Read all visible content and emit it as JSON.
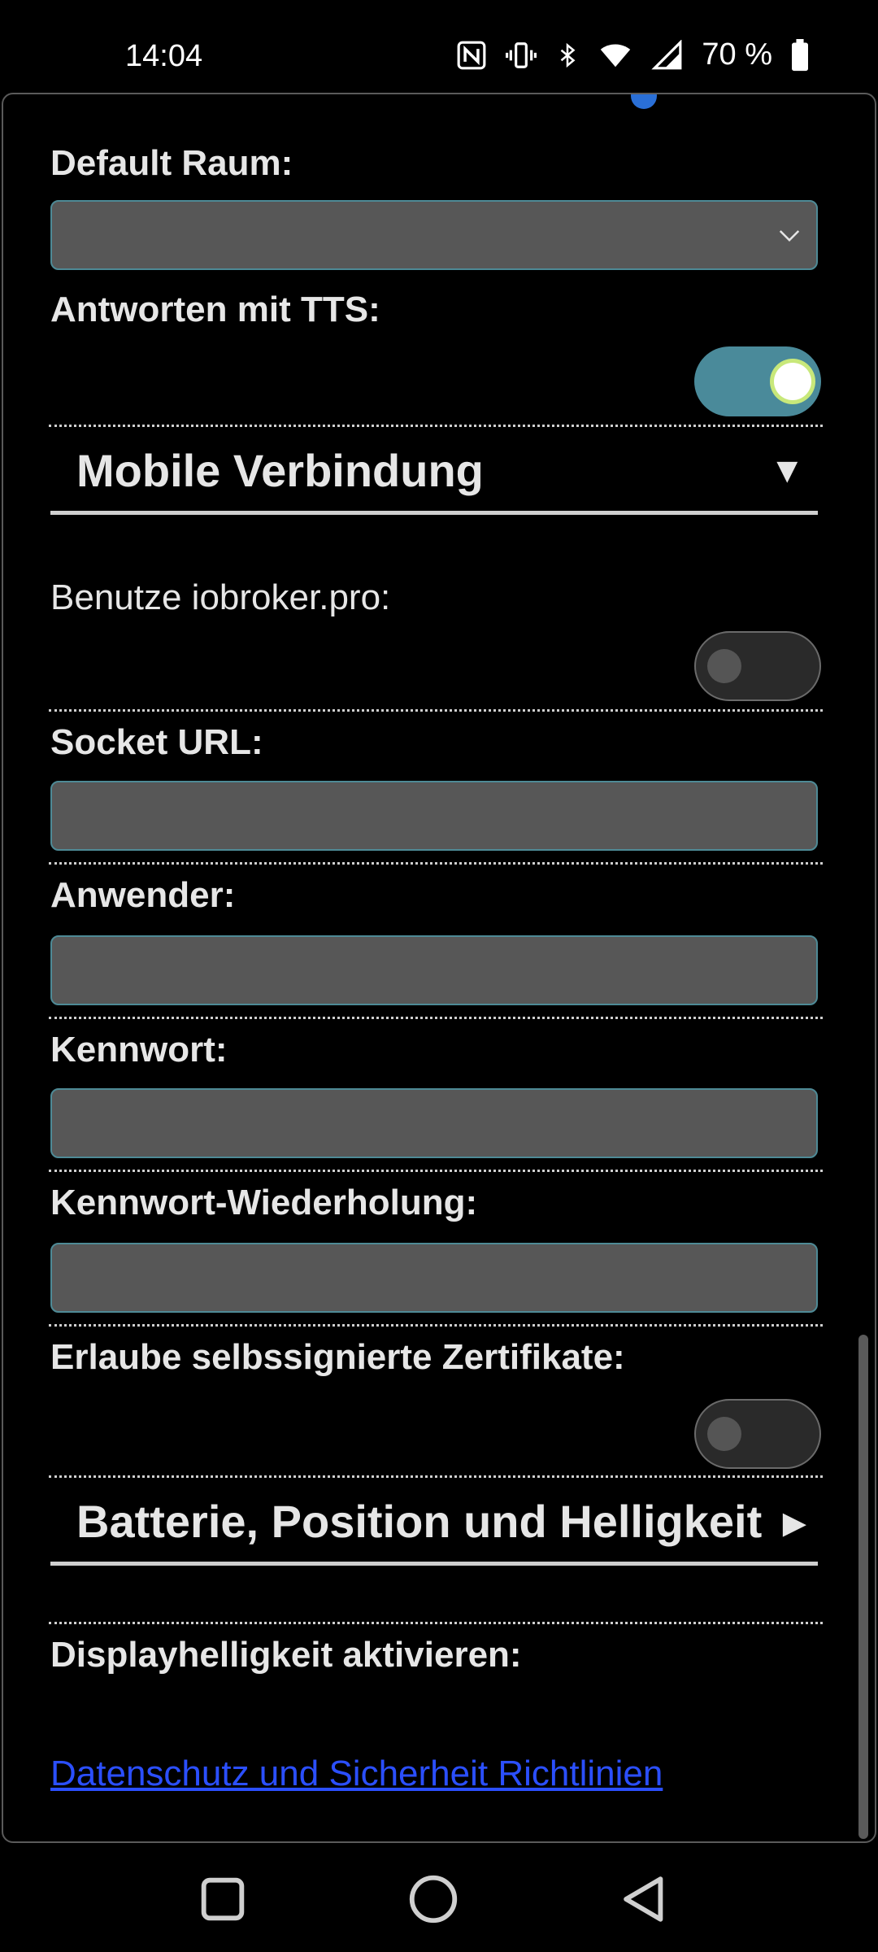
{
  "status_bar": {
    "time": "14:04",
    "battery_percent": "70 %",
    "icons": [
      "nfc-icon",
      "vibrate-icon",
      "bluetooth-icon",
      "wifi-icon",
      "signal-icon",
      "battery-icon"
    ]
  },
  "settings": {
    "default_room_label": "Default Raum:",
    "default_room_value": "",
    "tts_label": "Antworten mit TTS:",
    "tts_enabled": true,
    "mobile_section_title": "Mobile Verbindung",
    "mobile_section_arrow": "▼",
    "iobroker_label": "Benutze iobroker.pro:",
    "iobroker_enabled": false,
    "socket_url_label": "Socket URL:",
    "socket_url_value": "",
    "user_label": "Anwender:",
    "user_value": "",
    "password_label": "Kennwort:",
    "password_value": "",
    "password_repeat_label": "Kennwort-Wiederholung:",
    "password_repeat_value": "",
    "self_signed_label": "Erlaube selbssignierte Zertifikate:",
    "self_signed_enabled": false,
    "battery_section_title": "Batterie, Position und Helligkeit",
    "battery_section_arrow": "▶",
    "display_brightness_label": "Displayhelligkeit aktivieren:",
    "privacy_link": "Datenschutz und Sicherheit Richtlinien"
  },
  "colors": {
    "accent": "#4a8a9a",
    "field_bg": "#575757",
    "link": "#2b4fff"
  }
}
